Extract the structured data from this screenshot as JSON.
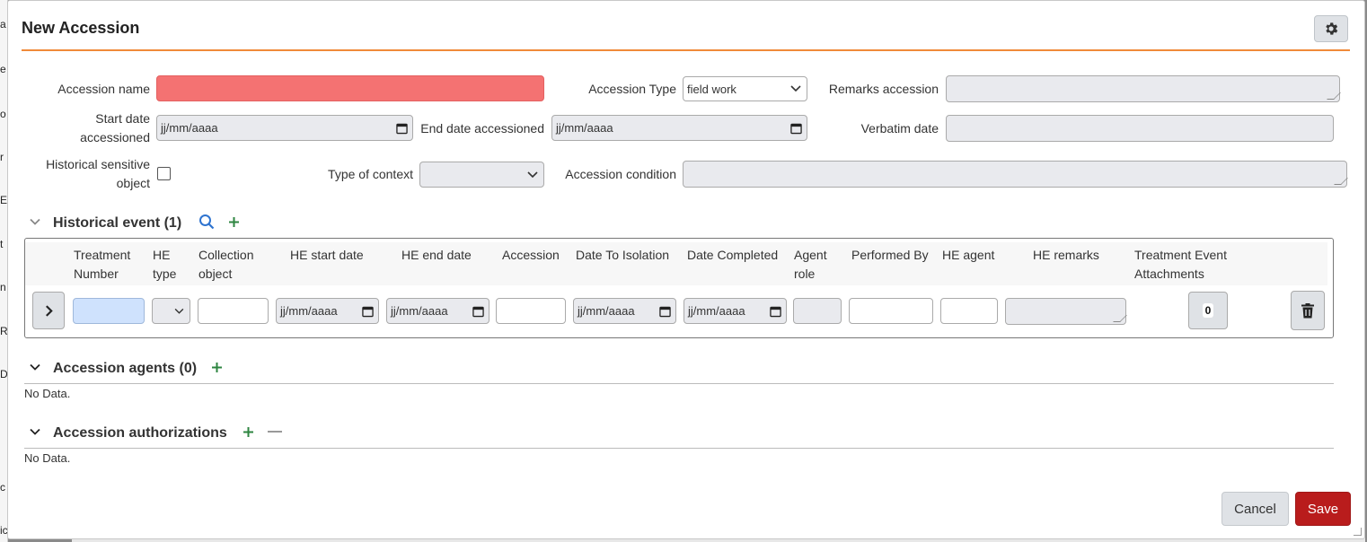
{
  "dialog": {
    "title": "New Accession"
  },
  "form": {
    "accession_name_label": "Accession name",
    "accession_type_label": "Accession Type",
    "accession_type_value": "field work",
    "remarks_label": "Remarks accession",
    "start_date_label_1": "Start date",
    "start_date_label_2": "accessioned",
    "start_date_placeholder": "jj/mm/aaaa",
    "end_date_label": "End date accessioned",
    "end_date_placeholder": "jj/mm/aaaa",
    "verbatim_label": "Verbatim date",
    "hist_sensitive_label_1": "Historical sensitive",
    "hist_sensitive_label_2": "object",
    "type_context_label": "Type of context",
    "condition_label": "Accession condition"
  },
  "historical_event": {
    "title": "Historical event (1)",
    "columns": [
      [
        "Treatment",
        "Number"
      ],
      [
        "HE",
        "type"
      ],
      [
        "Collection",
        "object"
      ],
      [
        "HE start date",
        ""
      ],
      [
        "HE end date",
        ""
      ],
      [
        "Accession",
        ""
      ],
      [
        "Date To Isolation",
        ""
      ],
      [
        "Date Completed",
        ""
      ],
      [
        "Agent",
        "role"
      ],
      [
        "Performed By",
        ""
      ],
      [
        "HE agent",
        ""
      ],
      [
        "HE remarks",
        ""
      ],
      [
        "Treatment Event",
        "Attachments"
      ]
    ],
    "date_placeholder": "jj/mm/aaaa",
    "attachments_count": "0"
  },
  "accession_agents": {
    "title": "Accession agents (0)",
    "no_data": "No Data."
  },
  "accession_authorizations": {
    "title": "Accession authorizations",
    "no_data": "No Data."
  },
  "buttons": {
    "cancel": "Cancel",
    "save": "Save"
  },
  "background": {
    "letters": [
      "a",
      "e",
      "o",
      "r",
      "E",
      "t",
      "n",
      "R",
      "D",
      "c",
      "ic"
    ]
  },
  "colors": {
    "accent": "#f08a3a",
    "required": "#f47272",
    "save": "#b91c1c",
    "icon_blue": "#2f74d0",
    "icon_green": "#2e8540"
  }
}
